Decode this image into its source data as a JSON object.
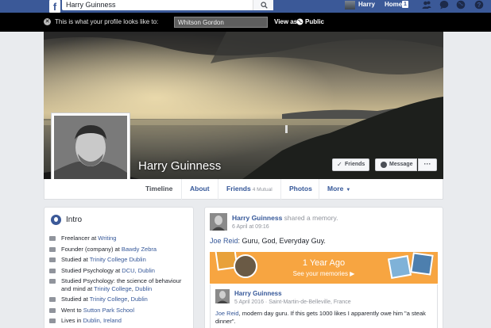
{
  "topbar": {
    "logo": "f",
    "search_value": "Harry Guinness",
    "user_name": "Harry",
    "home_label": "Home",
    "home_badge": "1",
    "icons": [
      "friend-requests-icon",
      "messages-icon",
      "globe-icon",
      "help-icon"
    ]
  },
  "preview_bar": {
    "close_glyph": "✕",
    "prompt": "This is what your profile looks like to:",
    "viewer_value": "Whitson Gordon",
    "view_as_label": "View as",
    "audience_label": "Public"
  },
  "profile": {
    "name": "Harry Guinness",
    "friends_button": "Friends",
    "message_button": "Message",
    "more_button": "···"
  },
  "tabs": [
    {
      "label": "Timeline"
    },
    {
      "label": "About"
    },
    {
      "label": "Friends",
      "sub": "4 Mutual"
    },
    {
      "label": "Photos"
    },
    {
      "label": "More",
      "caret": "▼"
    }
  ],
  "intro": {
    "title": "Intro",
    "items": [
      {
        "prefix": "Freelancer at ",
        "link": "Writing",
        "rest": "",
        "link2": ""
      },
      {
        "prefix": "Founder (company) at ",
        "link": "Bawdy Zebra",
        "rest": "",
        "link2": ""
      },
      {
        "prefix": "Studied at ",
        "link": "Trinity College Dublin",
        "rest": "",
        "link2": ""
      },
      {
        "prefix": "Studied Psychology at ",
        "link": "DCU, Dublin",
        "rest": "",
        "link2": ""
      },
      {
        "prefix": "Studied Psychology: the science of behaviour and mind at ",
        "link": "Trinity College",
        "rest": ", ",
        "link2": "Dublin"
      },
      {
        "prefix": "Studied at ",
        "link": "Trinity College",
        "rest": ", ",
        "link2": "Dublin"
      },
      {
        "prefix": "Went to ",
        "link": "Sutton Park School",
        "rest": "",
        "link2": ""
      },
      {
        "prefix": "Lives in ",
        "link": "Dublin, Ireland",
        "rest": "",
        "link2": ""
      }
    ]
  },
  "post": {
    "author": "Harry Guinness",
    "action": " shared a memory.",
    "date": "6 April at 09:16",
    "mention": "Joe Reid",
    "text": ": Guru, God, Everyday Guy.",
    "memory_title": "1 Year Ago",
    "memory_sub": "See your memories ▶",
    "shared_author": "Harry Guinness",
    "shared_meta": "5 April 2016 · Saint-Martin-de-Belleville, France",
    "shared_mention": "Joe Reid",
    "shared_text": ", modern day guru. If this gets 1000 likes I apparently owe him \"a steak dinner\"."
  },
  "colors": {
    "brand": "#3b5998",
    "link": "#365899",
    "memory": "#f7a541"
  }
}
